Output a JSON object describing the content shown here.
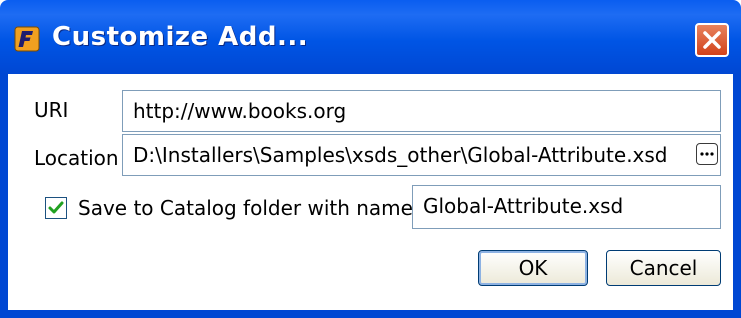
{
  "window": {
    "title": "Customize Add..."
  },
  "form": {
    "uri_label": "URI",
    "uri_value": "http://www.books.org",
    "location_label": "Location",
    "location_value": "D:\\Installers\\Samples\\xsds_other\\Global-Attribute.xsd",
    "save_checkbox_label": "Save to Catalog folder with name",
    "save_checked": true,
    "save_name_value": "Global-Attribute.xsd"
  },
  "buttons": {
    "ok_label": "OK",
    "cancel_label": "Cancel"
  },
  "colors": {
    "titlebar": "#0055e5",
    "close_button": "#d2421a",
    "checkmark": "#21a121"
  },
  "icons": {
    "app": "app-logo-icon",
    "close": "close-icon",
    "browse": "ellipsis-icon",
    "check": "checkmark-icon"
  }
}
